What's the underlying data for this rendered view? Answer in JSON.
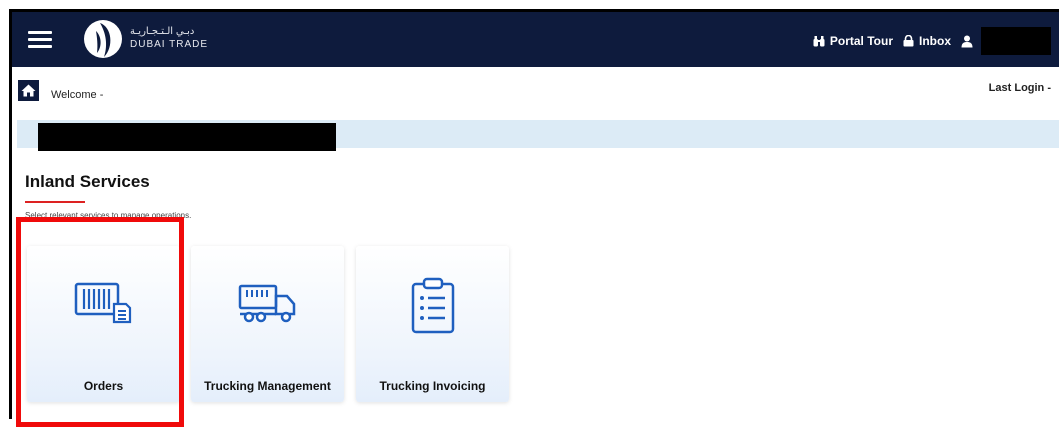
{
  "header": {
    "logo_ar": "دبـي الـتـجـاريـة",
    "logo_en": "DUBAI TRADE",
    "portal_tour": "Portal Tour",
    "inbox": "Inbox"
  },
  "welcome": {
    "text": "Welcome -",
    "last_login": "Last Login -"
  },
  "section": {
    "title": "Inland Services",
    "subtitle": "Select relevant services to manage operations."
  },
  "cards": [
    {
      "label": "Orders",
      "icon": "container-orders-icon"
    },
    {
      "label": "Trucking Management",
      "icon": "truck-icon"
    },
    {
      "label": "Trucking Invoicing",
      "icon": "clipboard-list-icon"
    }
  ],
  "colors": {
    "header_bg": "#0e1b3d",
    "accent_blue": "#1f5fbf",
    "info_bar": "#dcebf6",
    "highlight_red": "#f00a0a"
  }
}
